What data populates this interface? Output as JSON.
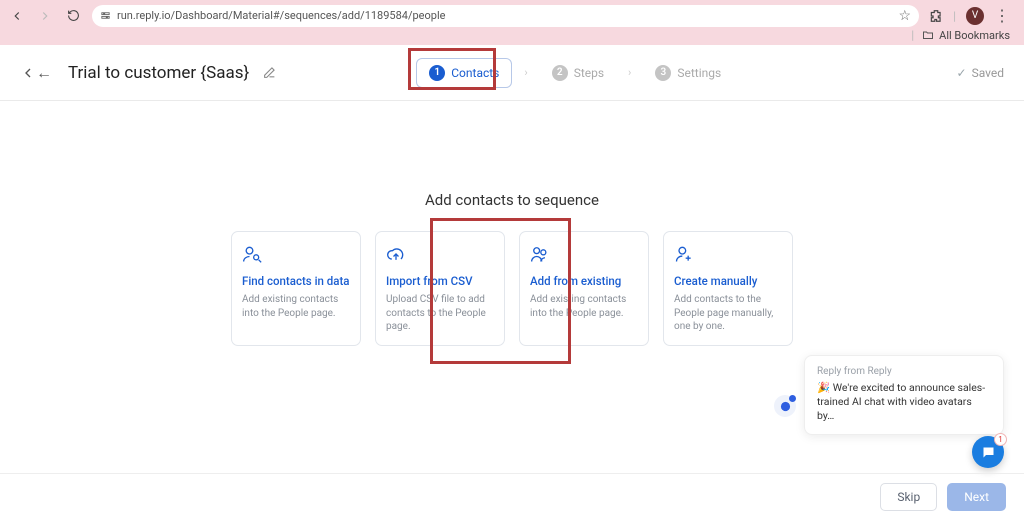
{
  "browser": {
    "url": "run.reply.io/Dashboard/Material#/sequences/add/1189584/people",
    "avatar_initial": "V",
    "bookmarks_label": "All Bookmarks"
  },
  "header": {
    "title": "Trial to customer {Saas}",
    "steps": [
      {
        "num": "1",
        "label": "Contacts"
      },
      {
        "num": "2",
        "label": "Steps"
      },
      {
        "num": "3",
        "label": "Settings"
      }
    ],
    "saved_label": "Saved"
  },
  "main": {
    "heading": "Add contacts to sequence",
    "cards": [
      {
        "title": "Find contacts in data",
        "desc": "Add existing contacts into the People page."
      },
      {
        "title": "Import from CSV",
        "desc": "Upload CSV file to add contacts to the People page."
      },
      {
        "title": "Add from existing",
        "desc": "Add existing contacts into the People page."
      },
      {
        "title": "Create manually",
        "desc": "Add contacts to the People page manually, one by one."
      }
    ]
  },
  "chat": {
    "from": "Reply from Reply",
    "message_prefix": "🎉 ",
    "message": "We're excited to announce sales-trained AI chat with video avatars by…",
    "badge": "1"
  },
  "footer": {
    "skip": "Skip",
    "next": "Next"
  }
}
